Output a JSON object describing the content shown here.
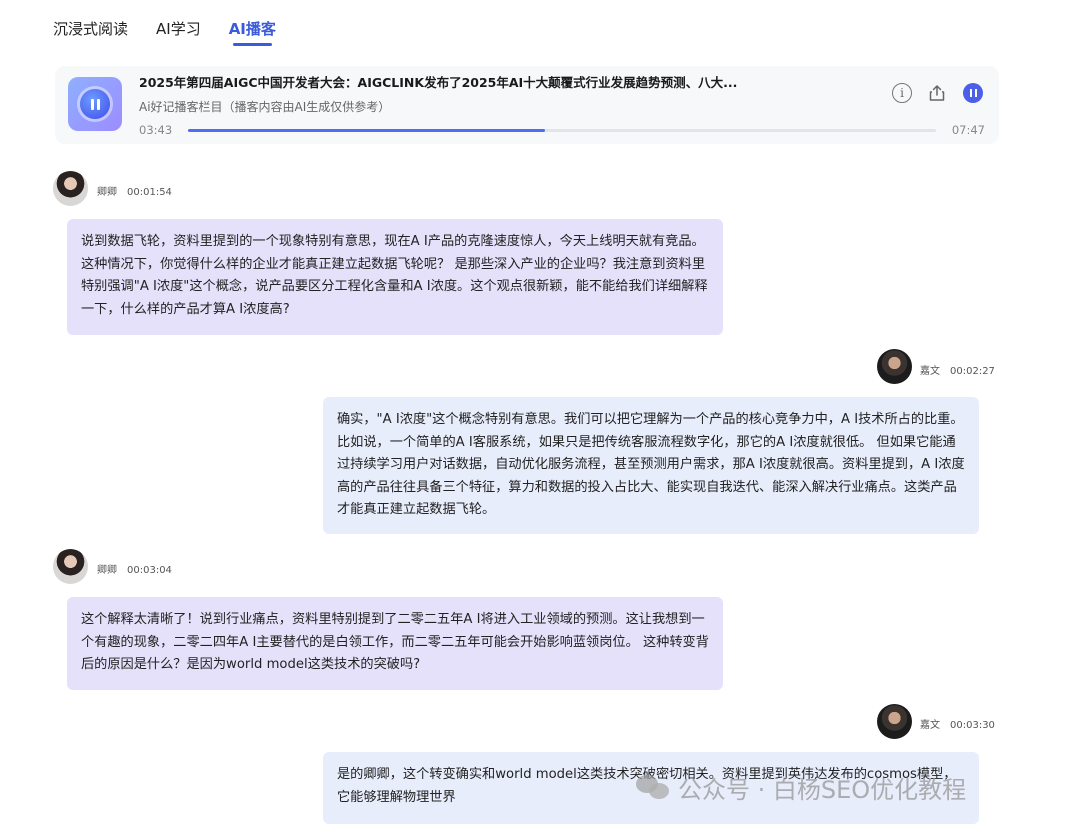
{
  "tabs": [
    {
      "label": "沉浸式阅读",
      "active": false
    },
    {
      "label": "AI学习",
      "active": false
    },
    {
      "label": "AI播客",
      "active": true
    }
  ],
  "player": {
    "title": "2025年第四届AIGC中国开发者大会：AIGCLINK发布了2025年AI十大颠覆式行业发展趋势预测、八大...",
    "subtitle": "Ai好记播客栏目（播客内容由AI生成仅供参考）",
    "current_time": "03:43",
    "total_time": "07:47",
    "progress_fraction": 0.477,
    "info_glyph": "i",
    "icons": {
      "cover": "pause-icon",
      "info": "info-icon",
      "share": "share-icon",
      "pause": "pause-icon"
    },
    "accent_color": "#4c6ef5"
  },
  "messages": [
    {
      "speaker": "卿卿",
      "time": "00:01:54",
      "side": "left",
      "text": "说到数据飞轮，资料里提到的一个现象特别有意思，现在A I产品的克隆速度惊人，今天上线明天就有竞品。这种情况下，你觉得什么样的企业才能真正建立起数据飞轮呢？ 是那些深入产业的企业吗？我注意到资料里特别强调\"A I浓度\"这个概念，说产品要区分工程化含量和A I浓度。这个观点很新颖，能不能给我们详细解释一下，什么样的产品才算A I浓度高?"
    },
    {
      "speaker": "嘉文",
      "time": "00:02:27",
      "side": "right",
      "text": "确实，\"A I浓度\"这个概念特别有意思。我们可以把它理解为一个产品的核心竞争力中，A I技术所占的比重。比如说，一个简单的A I客服系统，如果只是把传统客服流程数字化，那它的A I浓度就很低。 但如果它能通过持续学习用户对话数据，自动优化服务流程，甚至预测用户需求，那A I浓度就很高。资料里提到，A I浓度高的产品往往具备三个特征，算力和数据的投入占比大、能实现自我迭代、能深入解决行业痛点。这类产品才能真正建立起数据飞轮。"
    },
    {
      "speaker": "卿卿",
      "time": "00:03:04",
      "side": "left",
      "text": "这个解释太清晰了！说到行业痛点，资料里特别提到了二零二五年A I将进入工业领域的预测。这让我想到一个有趣的现象，二零二四年A I主要替代的是白领工作，而二零二五年可能会开始影响蓝领岗位。 这种转变背后的原因是什么？是因为world model这类技术的突破吗?"
    },
    {
      "speaker": "嘉文",
      "time": "00:03:30",
      "side": "right",
      "text": "是的卿卿，这个转变确实和world model这类技术突破密切相关。资料里提到英伟达发布的cosmos模型，它能够理解物理世界"
    }
  ],
  "watermark": {
    "text": "公众号 · 白杨SEO优化教程",
    "icon": "wechat-icon"
  }
}
